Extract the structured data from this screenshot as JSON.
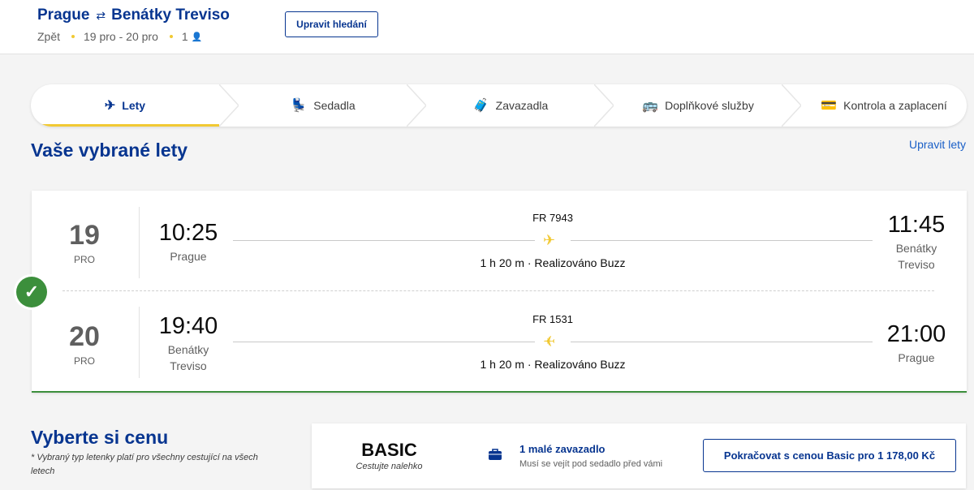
{
  "header": {
    "origin": "Prague",
    "destination": "Benátky Treviso",
    "back_label": "Zpět",
    "dates": "19 pro - 20 pro",
    "passengers": "1",
    "edit_search_label": "Upravit hledání"
  },
  "steps": [
    {
      "label": "Lety",
      "icon": "plane-icon"
    },
    {
      "label": "Sedadla",
      "icon": "seat-icon"
    },
    {
      "label": "Zavazadla",
      "icon": "luggage-icon"
    },
    {
      "label": "Doplňkové služby",
      "icon": "bus-icon"
    },
    {
      "label": "Kontrola a zaplacení",
      "icon": "card-icon"
    }
  ],
  "selected_flights": {
    "title": "Vaše vybrané lety",
    "edit_link": "Upravit lety",
    "flights": [
      {
        "day": "19",
        "month": "PRO",
        "dep_time": "10:25",
        "dep_city": "Prague",
        "flight_no": "FR 7943",
        "duration": "1 h 20 m · Realizováno Buzz",
        "arr_time": "11:45",
        "arr_city": "Benátky Treviso"
      },
      {
        "day": "20",
        "month": "PRO",
        "dep_time": "19:40",
        "dep_city": "Benátky Treviso",
        "flight_no": "FR 1531",
        "duration": "1 h 20 m · Realizováno Buzz",
        "arr_time": "21:00",
        "arr_city": "Prague"
      }
    ]
  },
  "pricing": {
    "title": "Vyberte si cenu",
    "note": "* Vybraný typ letenky platí pro všechny cestující na všech letech",
    "fare_name": "BASIC",
    "fare_tagline": "Cestujte nalehko",
    "bag_title": "1 malé zavazadlo",
    "bag_subtitle": "Musí se vejít pod sedadlo před vámi",
    "continue_label": "Pokračovat s cenou Basic pro 1 178,00 Kč"
  },
  "colors": {
    "brand_blue": "#073590",
    "accent_yellow": "#f1c933",
    "success_green": "#3c8f3c"
  }
}
